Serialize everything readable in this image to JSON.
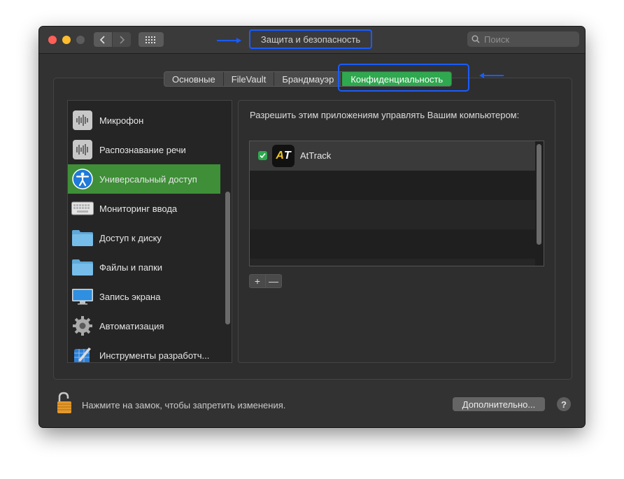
{
  "window": {
    "title": "Защита и безопасность",
    "search_placeholder": "Поиск"
  },
  "tabs": [
    "Основные",
    "FileVault",
    "Брандмауэр",
    "Конфиденциальность"
  ],
  "active_tab": "Конфиденциальность",
  "sidebar": {
    "items": [
      {
        "label": "Микрофон",
        "icon": "microphone-icon"
      },
      {
        "label": "Распознавание речи",
        "icon": "speech-recognition-icon"
      },
      {
        "label": "Универсальный доступ",
        "icon": "accessibility-icon",
        "selected": true
      },
      {
        "label": "Мониторинг ввода",
        "icon": "keyboard-icon"
      },
      {
        "label": "Доступ к диску",
        "icon": "folder-icon"
      },
      {
        "label": "Файлы и папки",
        "icon": "folder-icon"
      },
      {
        "label": "Запись экрана",
        "icon": "display-icon"
      },
      {
        "label": "Автоматизация",
        "icon": "gear-icon"
      },
      {
        "label": "Инструменты разработч...",
        "icon": "developer-tools-icon"
      }
    ]
  },
  "content": {
    "heading": "Разрешить этим приложениям управлять Вашим компьютером:",
    "apps": [
      {
        "name": "AtTrack",
        "icon_text_a": "A",
        "icon_text_t": "T",
        "checked": true
      }
    ],
    "add_label": "+",
    "remove_label": "—"
  },
  "footer": {
    "lock_text": "Нажмите на замок, чтобы запретить изменения.",
    "advanced_label": "Дополнительно...",
    "help_label": "?"
  },
  "colors": {
    "accent_green": "#2fa84f",
    "highlight_blue": "#1a5cff"
  }
}
